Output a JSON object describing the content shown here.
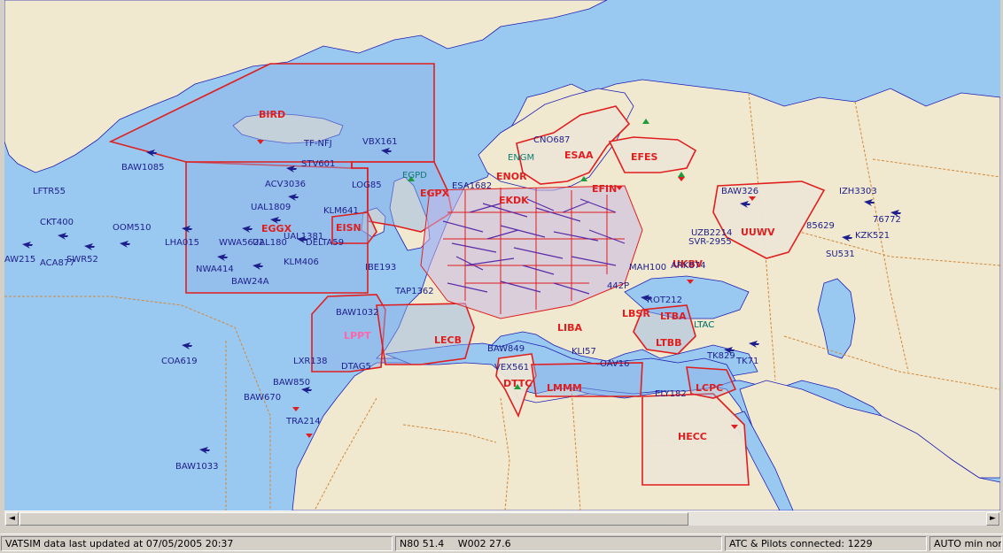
{
  "status": {
    "data_updated": "VATSIM data last updated at 07/05/2005 20:37",
    "latitude": "N80 51.4",
    "longitude": "W002 27.6",
    "connected": "ATC & Pilots connected: 1229",
    "mode": "AUTO min norm"
  },
  "scrollbar": {
    "left_arrow": "◄",
    "right_arrow": "►"
  },
  "colors": {
    "sea": "#99c9f1",
    "land": "#f0e9cf",
    "fir_fill": "#8fb2e6",
    "fir_border": "#e01e1e",
    "aircraft": "#1e1e8c",
    "airport": "#0f7a72",
    "country_border": "#d2873a"
  },
  "map": {
    "fir_labels": [
      {
        "text": "BIRD"
      },
      {
        "text": "EGPX"
      },
      {
        "text": "EGGX"
      },
      {
        "text": "EISN"
      },
      {
        "text": "ESAA"
      },
      {
        "text": "EFES"
      },
      {
        "text": "UUWV"
      },
      {
        "text": "LTBB"
      },
      {
        "text": "LCPC"
      },
      {
        "text": "HECC"
      },
      {
        "text": "LMMM"
      },
      {
        "text": "DTTC"
      },
      {
        "text": "LPPT"
      },
      {
        "text": "LBSR"
      },
      {
        "text": "ENOR"
      },
      {
        "text": "LIBA"
      },
      {
        "text": "UKBV"
      },
      {
        "text": "LTAC"
      },
      {
        "text": "LTBA"
      },
      {
        "text": "LECB"
      },
      {
        "text": "EKDK"
      },
      {
        "text": "EFIN"
      }
    ],
    "aircraft_labels": [
      {
        "text": "TF-NFJ"
      },
      {
        "text": "VBX161"
      },
      {
        "text": "BAW1085"
      },
      {
        "text": "STV601"
      },
      {
        "text": "ACV3036"
      },
      {
        "text": "LFTR55"
      },
      {
        "text": "UAL1809"
      },
      {
        "text": "KLM641"
      },
      {
        "text": "CKT400"
      },
      {
        "text": "OOM510"
      },
      {
        "text": "LHA015"
      },
      {
        "text": "WWA5622"
      },
      {
        "text": "UAL180"
      },
      {
        "text": "UAL1381"
      },
      {
        "text": "DELTA59"
      },
      {
        "text": "AW215"
      },
      {
        "text": "SWR52"
      },
      {
        "text": "ACA877"
      },
      {
        "text": "KLM406"
      },
      {
        "text": "NWA414"
      },
      {
        "text": "BAW24A"
      },
      {
        "text": "BAW1032"
      },
      {
        "text": "COA619"
      },
      {
        "text": "LXR138"
      },
      {
        "text": "BAW850"
      },
      {
        "text": "BAW670"
      },
      {
        "text": "TRA214"
      },
      {
        "text": "BAW1033"
      },
      {
        "text": "BAW326"
      },
      {
        "text": "IZH3303"
      },
      {
        "text": "76772"
      },
      {
        "text": "85629"
      },
      {
        "text": "KZK521"
      },
      {
        "text": "SU531"
      },
      {
        "text": "SVR-2955"
      },
      {
        "text": "ROT212"
      },
      {
        "text": "TK829"
      },
      {
        "text": "TK71"
      },
      {
        "text": "ELY182"
      },
      {
        "text": "VEX561"
      },
      {
        "text": "BAW849"
      },
      {
        "text": "CNO687"
      },
      {
        "text": "ESA1682"
      },
      {
        "text": "LOG85"
      },
      {
        "text": "IBE193"
      },
      {
        "text": "TAP1362"
      },
      {
        "text": "DTAG5"
      },
      {
        "text": "KLI57"
      },
      {
        "text": "OAV16"
      },
      {
        "text": "MAH100"
      },
      {
        "text": "UZB2214"
      },
      {
        "text": "ARK874"
      },
      {
        "text": "442P"
      }
    ],
    "airport_labels": [
      {
        "text": "EGPD"
      },
      {
        "text": "ENGM"
      },
      {
        "text": "LTAC"
      }
    ]
  }
}
